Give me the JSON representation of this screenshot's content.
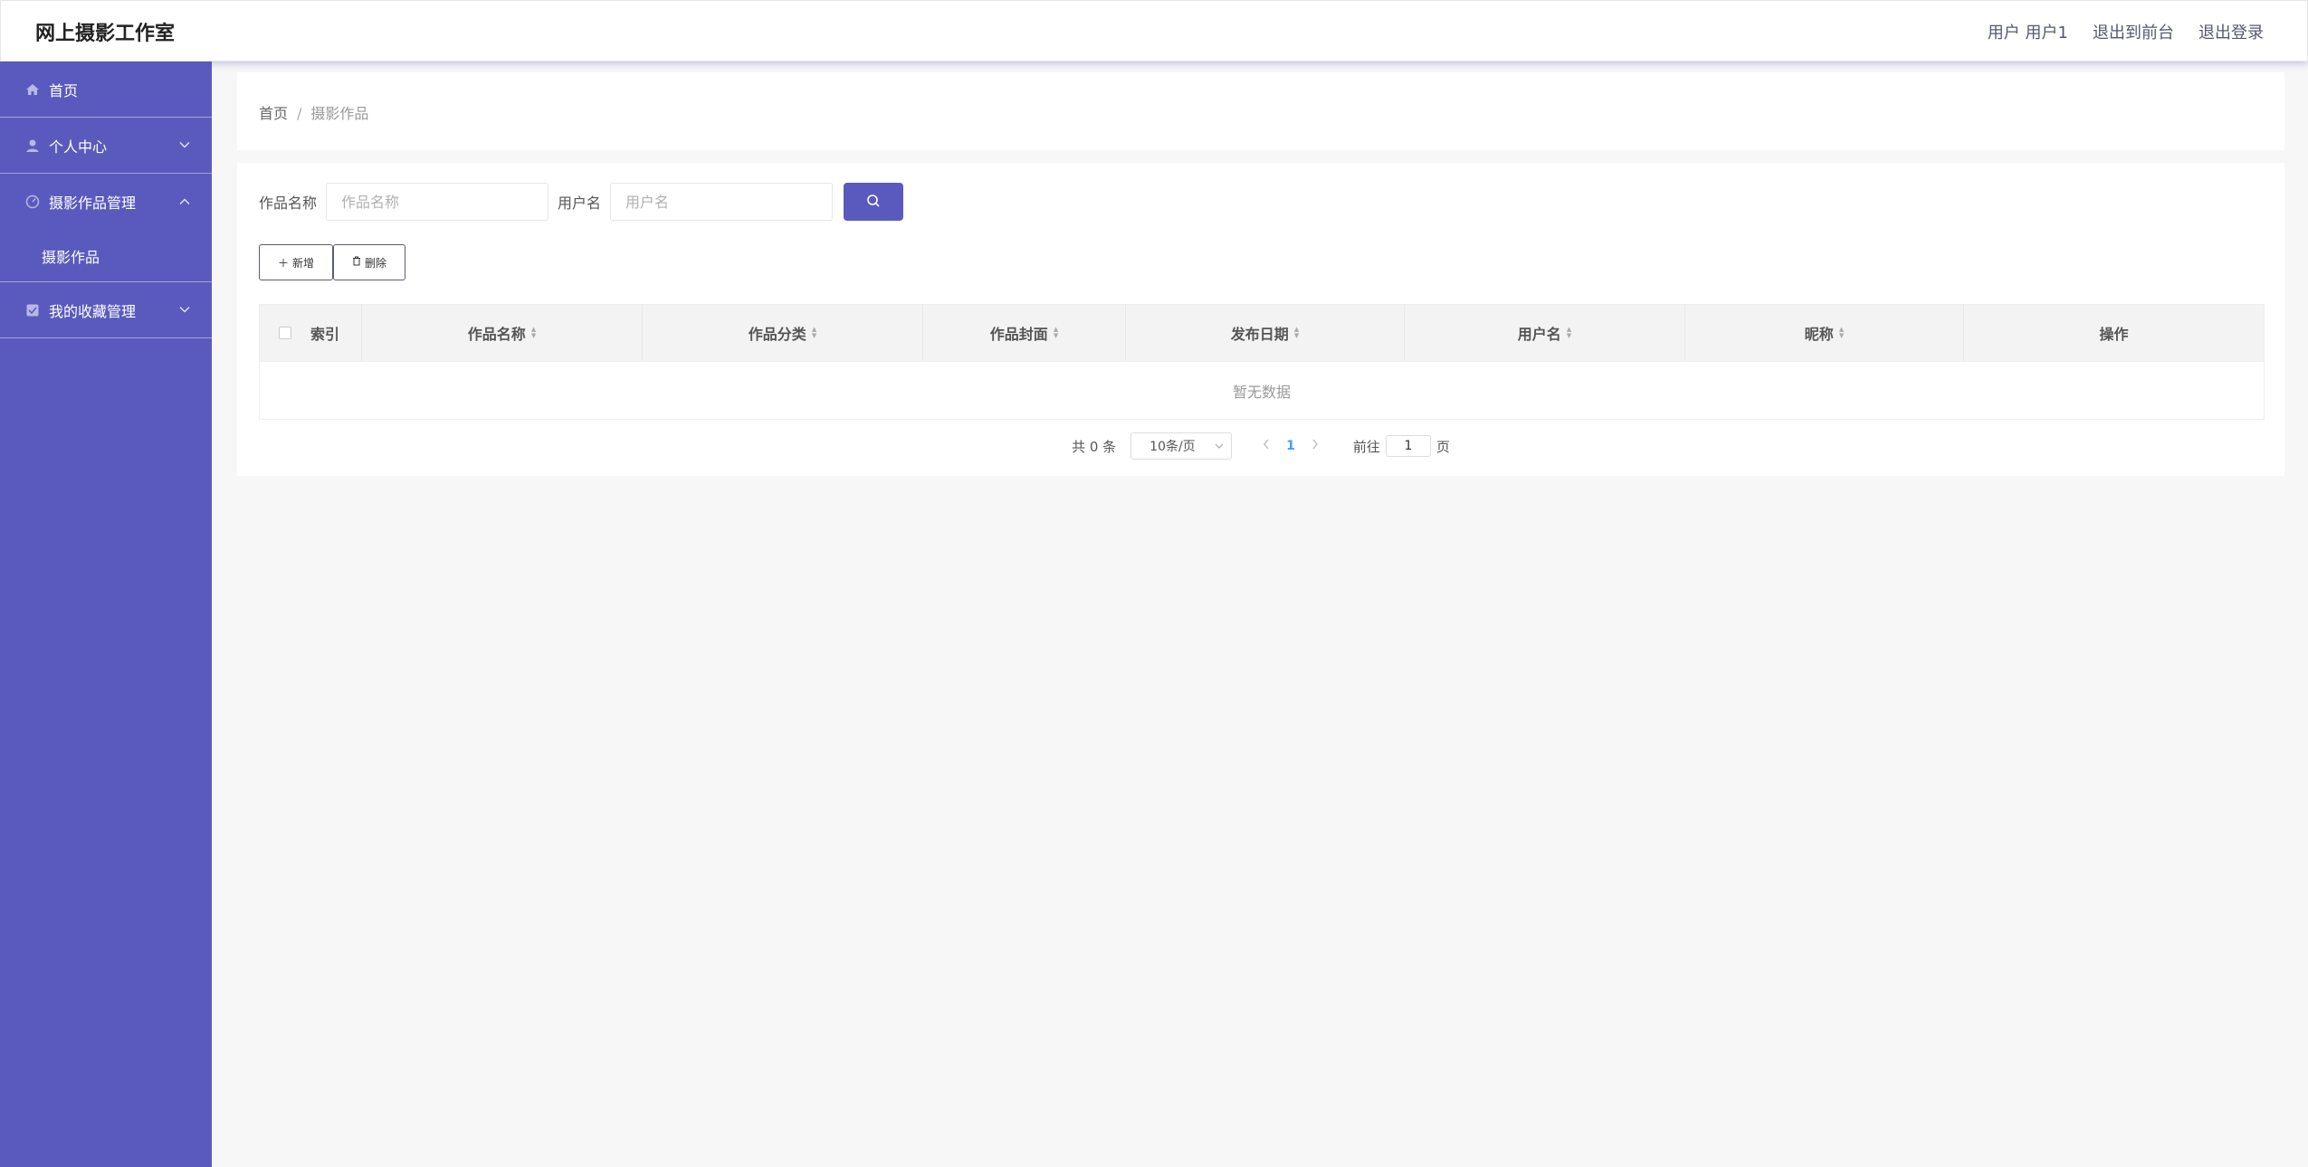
{
  "header": {
    "app_title": "网上摄影工作室",
    "user_label": "用户 用户1",
    "to_front_label": "退出到前台",
    "logout_label": "退出登录"
  },
  "sidebar": {
    "items": [
      {
        "label": "首页",
        "icon": "home-icon"
      },
      {
        "label": "个人中心",
        "icon": "user-icon"
      },
      {
        "label": "摄影作品管理",
        "icon": "gauge-icon",
        "expanded": true,
        "children": [
          "摄影作品"
        ]
      },
      {
        "label": "我的收藏管理",
        "icon": "checkbox-icon"
      }
    ]
  },
  "breadcrumb": {
    "home": "首页",
    "separator": "/",
    "current": "摄影作品"
  },
  "search": {
    "title_label": "作品名称",
    "title_placeholder": "作品名称",
    "user_label": "用户名",
    "user_placeholder": "用户名"
  },
  "actions": {
    "add_label": "新增",
    "delete_label": "删除"
  },
  "table": {
    "columns": [
      "索引",
      "作品名称",
      "作品分类",
      "作品封面",
      "发布日期",
      "用户名",
      "昵称",
      "操作"
    ],
    "empty_text": "暂无数据"
  },
  "pagination": {
    "total_text": "共 0 条",
    "page_size": "10条/页",
    "current_page": "1",
    "goto_label": "前往",
    "goto_value": "1",
    "page_suffix": "页"
  },
  "colors": {
    "accent": "#5a5abe",
    "page_number": "#409eff"
  }
}
